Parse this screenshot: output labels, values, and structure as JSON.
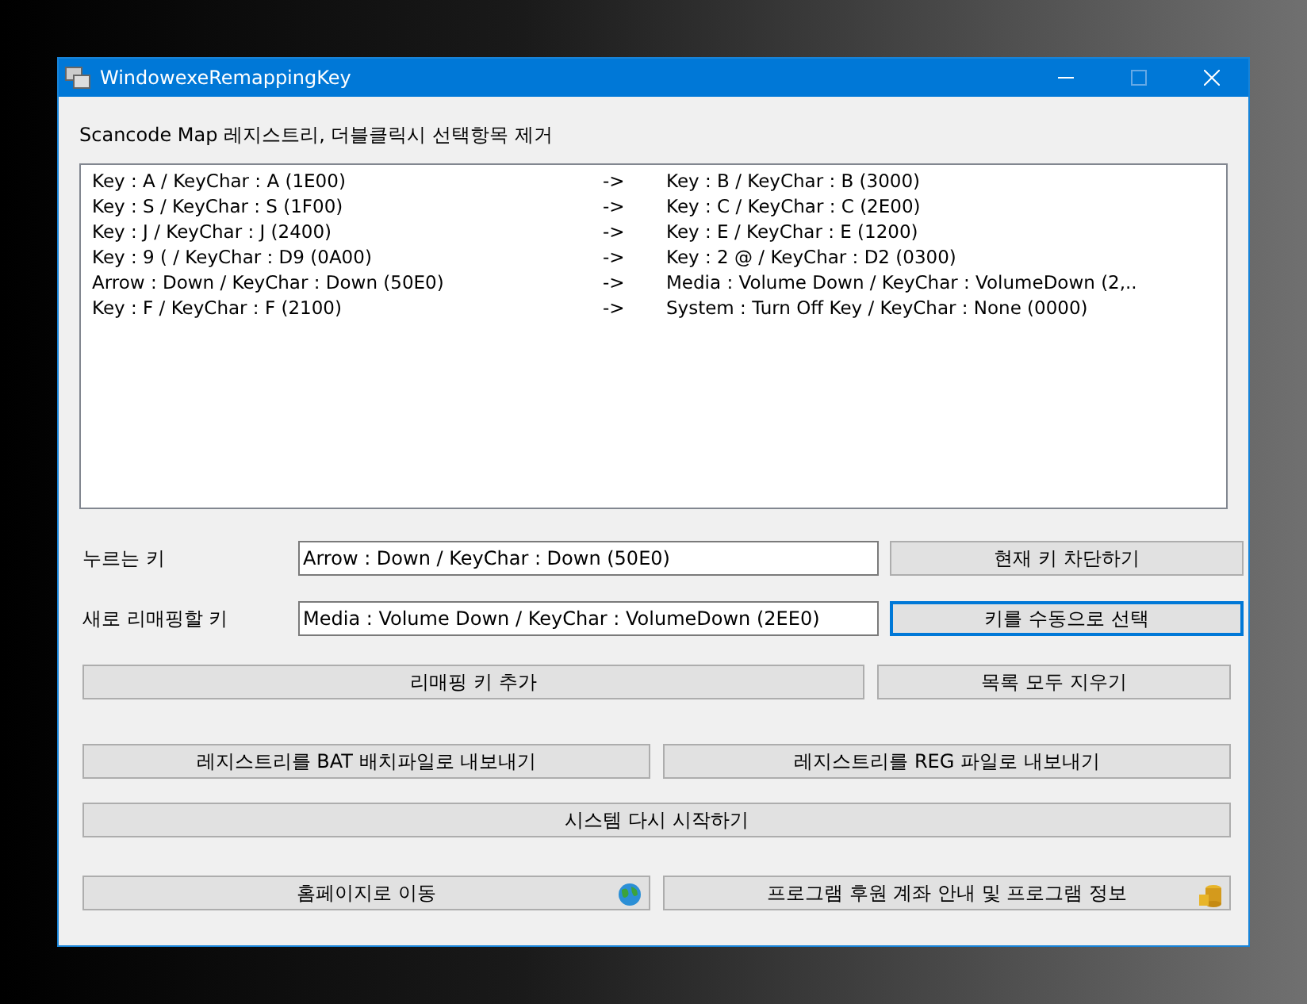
{
  "window": {
    "title": "WindowexeRemappingKey"
  },
  "list_label": "Scancode Map 레지스트리, 더블클릭시 선택항목 제거",
  "mappings": [
    {
      "from": "Key : A / KeyChar : A (1E00)",
      "arrow": "->",
      "to": "Key : B / KeyChar : B (3000)"
    },
    {
      "from": "Key : S / KeyChar : S (1F00)",
      "arrow": "->",
      "to": "Key : C / KeyChar : C (2E00)"
    },
    {
      "from": "Key : J / KeyChar : J (2400)",
      "arrow": "->",
      "to": "Key : E / KeyChar : E (1200)"
    },
    {
      "from": "Key : 9 ( / KeyChar : D9 (0A00)",
      "arrow": "->",
      "to": "Key : 2 @ / KeyChar : D2 (0300)"
    },
    {
      "from": "Arrow : Down / KeyChar : Down (50E0)",
      "arrow": "->",
      "to": "Media : Volume Down / KeyChar : VolumeDown (2,.."
    },
    {
      "from": "Key : F / KeyChar : F (2100)",
      "arrow": "->",
      "to": "System : Turn Off Key / KeyChar : None (0000)"
    }
  ],
  "fields": [
    {
      "label": "누르는 키",
      "value": "Arrow : Down / KeyChar : Down (50E0)",
      "button": {
        "label": "현재 키 차단하기",
        "focused": false
      }
    },
    {
      "label": "새로 리매핑할 키",
      "value": "Media : Volume Down / KeyChar : VolumeDown (2EE0)",
      "button": {
        "label": "키를 수동으로 선택",
        "focused": true
      }
    }
  ],
  "button_rows": [
    [
      {
        "label": "리매핑 키 추가",
        "icon": false
      },
      {
        "label": "목록 모두 지우기",
        "icon": false
      }
    ],
    [
      {
        "label": "레지스트리를 BAT 배치파일로 내보내기",
        "icon": false
      },
      {
        "label": "레지스트리를 REG 파일로 내보내기",
        "icon": false
      }
    ],
    [
      {
        "label": "시스템 다시 시작하기",
        "icon": false
      }
    ],
    [
      {
        "label": "홈페이지로 이동",
        "icon": true
      },
      {
        "label": "프로그램 후원 계좌 안내 및 프로그램 정보",
        "icon": true
      }
    ]
  ]
}
